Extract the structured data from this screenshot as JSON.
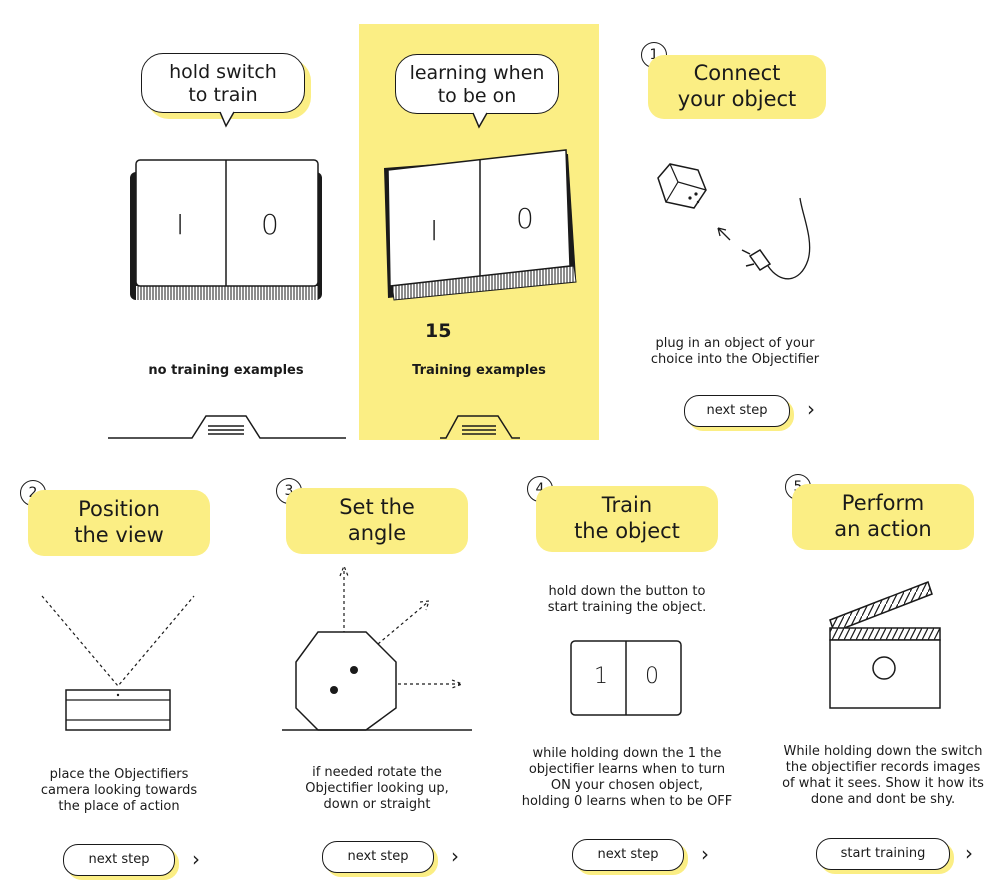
{
  "panel_off": {
    "bubble": [
      "hold switch",
      "to train"
    ],
    "switch_labels": [
      "I",
      "0"
    ],
    "caption": "no training examples"
  },
  "panel_on": {
    "bubble": [
      "learning when",
      "to be on"
    ],
    "switch_labels": [
      "I",
      "0"
    ],
    "count": "15",
    "caption": "Training examples"
  },
  "steps": [
    {
      "number": "1",
      "title": [
        "Connect",
        "your object"
      ],
      "desc": [
        "plug in an object of your",
        "choice into the Objectifier"
      ],
      "button": "next step",
      "chevron": "›"
    },
    {
      "number": "2",
      "title": [
        "Position",
        "the view"
      ],
      "desc": [
        "place the Objectifiers",
        "camera looking towards",
        "the place of action"
      ],
      "button": "next step",
      "chevron": "›"
    },
    {
      "number": "3",
      "title": [
        "Set the",
        "angle"
      ],
      "desc": [
        "if needed rotate the",
        "Objectifier looking up,",
        "down or straight"
      ],
      "button": "next step",
      "chevron": "›"
    },
    {
      "number": "4",
      "title": [
        "Train",
        "the object"
      ],
      "intro": [
        "hold down the button to",
        "start training the object."
      ],
      "switch_labels": [
        "1",
        "0"
      ],
      "desc": [
        "while holding down the 1 the",
        "objectifier learns when to turn",
        "ON your chosen object,",
        "holding 0 learns when to be OFF"
      ],
      "button": "next step",
      "chevron": "›"
    },
    {
      "number": "5",
      "title": [
        "Perform",
        "an action"
      ],
      "desc": [
        "While holding down the switch",
        "the objectifier records images",
        "of what it sees. Show it how its",
        "done and dont be shy."
      ],
      "button": "start training",
      "chevron": "›"
    }
  ],
  "colors": {
    "accent": "#fbee84",
    "ink": "#1a1a1a"
  }
}
